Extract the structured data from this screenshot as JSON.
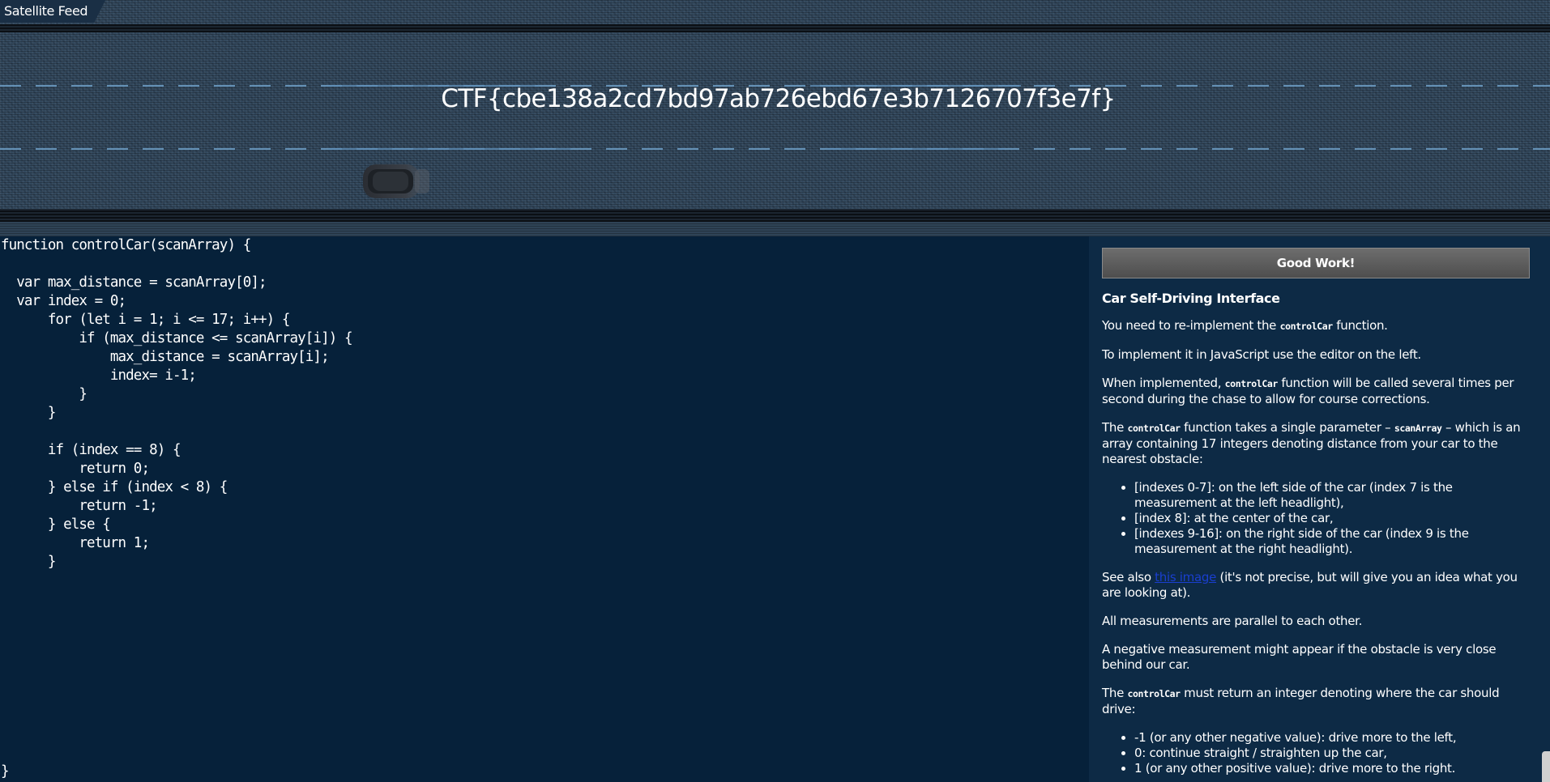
{
  "feed": {
    "tab_label": "Satellite Feed",
    "flag": "CTF{cbe138a2cd7bd97ab726ebd67e3b7126707f3e7f}"
  },
  "editor": {
    "lines": [
      "function controlCar(scanArray) {",
      "",
      "  var max_distance = scanArray[0];",
      "  var index = 0;",
      "      for (let i = 1; i <= 17; i++) {",
      "          if (max_distance <= scanArray[i]) {",
      "              max_distance = scanArray[i];",
      "              index= i-1;",
      "          }",
      "      }",
      "",
      "      if (index == 8) {",
      "          return 0;",
      "      } else if (index < 8) {",
      "          return -1;",
      "      } else {",
      "          return 1;",
      "      }"
    ],
    "closing_brace": "}"
  },
  "panel": {
    "status_button": "Good Work!",
    "heading": "Car Self-Driving Interface",
    "fn_name": "controlCar",
    "param_name": "scanArray",
    "p1_before": "You need to re-implement the ",
    "p1_after": " function.",
    "p2": "To implement it in JavaScript use the editor on the left.",
    "p3_before": "When implemented, ",
    "p3_after": " function will be called several times per second during the chase to allow for course corrections.",
    "p4_before": "The ",
    "p4_mid": " function takes a single parameter – ",
    "p4_after": " – which is an array containing 17 integers denoting distance from your car to the nearest obstacle:",
    "index_items": [
      "[indexes 0-7]: on the left side of the car (index 7 is the measurement at the left headlight),",
      "[index 8]: at the center of the car,",
      "[indexes 9-16]: on the right side of the car (index 9 is the measurement at the right headlight)."
    ],
    "p5_before": "See also ",
    "p5_link": "this image",
    "p5_after": " (it's not precise, but will give you an idea what you are looking at).",
    "p6": "All measurements are parallel to each other.",
    "p7": "A negative measurement might appear if the obstacle is very close behind our car.",
    "p8_before": "The ",
    "p8_after": " must return an integer denoting where the car should drive:",
    "return_items": [
      "-1 (or any other negative value): drive more to the left,",
      "0: continue straight / straighten up the car,",
      "1 (or any other positive value): drive more to the right."
    ]
  }
}
